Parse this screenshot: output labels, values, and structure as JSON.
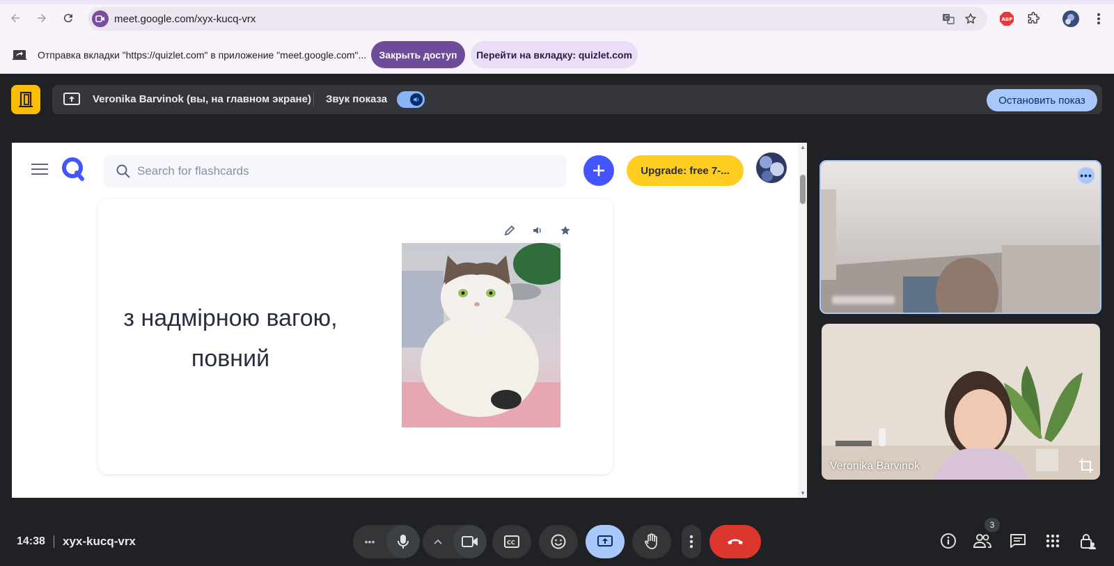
{
  "browser": {
    "url": "meet.google.com/xyx-kucq-vrx"
  },
  "infobar": {
    "message": "Отправка вкладки \"https://quizlet.com\" в приложение \"meet.google.com\"...",
    "close_access_label": "Закрыть доступ",
    "go_to_tab_label": "Перейти на вкладку: quizlet.com"
  },
  "presenting": {
    "presenter_label": "Veronika Barvinok (вы, на главном экране)",
    "audio_label": "Звук показа",
    "audio_on": true,
    "stop_label": "Остановить показ"
  },
  "quizlet": {
    "search_placeholder": "Search for flashcards",
    "upgrade_label": "Upgrade: free 7-...",
    "card": {
      "term": "з надмірною вагою, повний"
    },
    "colors": {
      "brand_blue": "#4255ff",
      "upgrade_yellow": "#ffcd1f"
    }
  },
  "participants": {
    "tile_1_name_hidden": true,
    "tile_2_name": "Veronika Barvinok"
  },
  "controls": {
    "time": "14:38",
    "meeting_code": "xyx-kucq-vrx",
    "people_count": "3"
  },
  "colors": {
    "meet_bg": "#202124",
    "end_call_red": "#dc362e",
    "present_blue": "#a8c7fa"
  }
}
